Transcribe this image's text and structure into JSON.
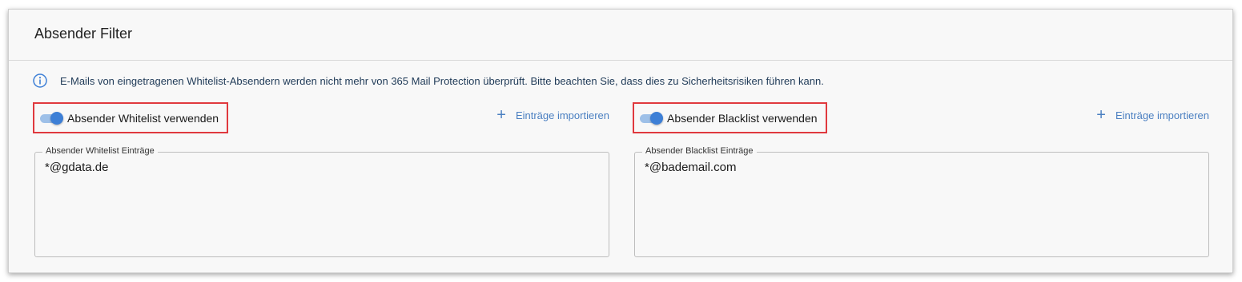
{
  "panel": {
    "title": "Absender Filter"
  },
  "info": {
    "icon": "info-circle-icon",
    "text": "E-Mails von eingetragenen Whitelist-Absendern werden nicht mehr von 365 Mail Protection überprüft. Bitte beachten Sie, dass dies zu Sicherheitsrisiken führen kann."
  },
  "whitelist": {
    "toggle_label": "Absender Whitelist verwenden",
    "toggle_on": true,
    "import_label": "Einträge importieren",
    "field_label": "Absender Whitelist Einträge",
    "entries": "*@gdata.de"
  },
  "blacklist": {
    "toggle_label": "Absender Blacklist verwenden",
    "toggle_on": true,
    "import_label": "Einträge importieren",
    "field_label": "Absender Blacklist Einträge",
    "entries": "*@bademail.com"
  },
  "colors": {
    "accent": "#3d7fd6",
    "highlight_border": "#e0393e",
    "link": "#4a7fc1"
  }
}
